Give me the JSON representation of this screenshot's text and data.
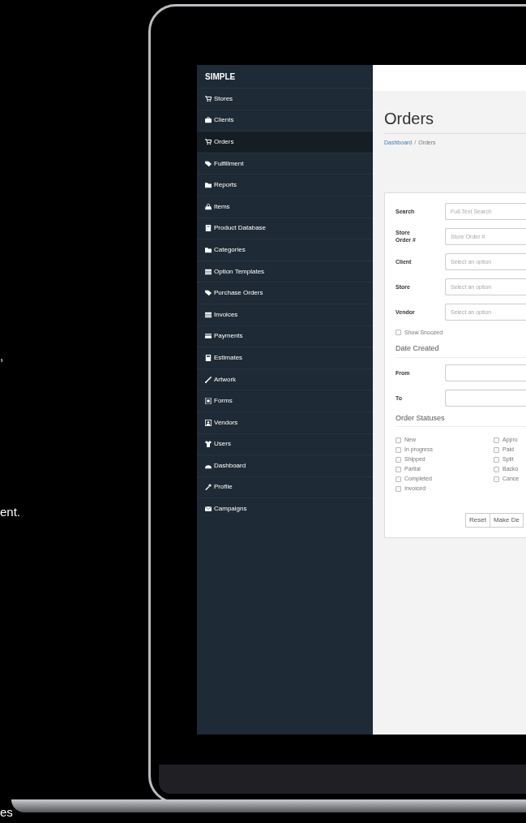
{
  "side_text": [
    ",",
    "ent.",
    "es"
  ],
  "sidebar": {
    "brand": "SIMPLE",
    "items": [
      {
        "label": "Stores",
        "kind": "cart",
        "selected": false
      },
      {
        "label": "Clients",
        "kind": "briefcase",
        "selected": false
      },
      {
        "label": "Orders",
        "kind": "cart",
        "selected": true
      },
      {
        "label": "Fulfillment",
        "kind": "tag",
        "selected": false
      },
      {
        "label": "Reports",
        "kind": "folder",
        "selected": false
      },
      {
        "label": "Items",
        "kind": "bag",
        "selected": false
      },
      {
        "label": "Product Database",
        "kind": "book",
        "selected": false
      },
      {
        "label": "Categories",
        "kind": "folder",
        "selected": false
      },
      {
        "label": "Option Templates",
        "kind": "table",
        "selected": false
      },
      {
        "label": "Purchase Orders",
        "kind": "tag",
        "selected": false
      },
      {
        "label": "Invoices",
        "kind": "table",
        "selected": false
      },
      {
        "label": "Payments",
        "kind": "card",
        "selected": false
      },
      {
        "label": "Estimates",
        "kind": "calculator",
        "selected": false
      },
      {
        "label": "Artwork",
        "kind": "brush",
        "selected": false
      },
      {
        "label": "Forms",
        "kind": "document",
        "selected": false
      },
      {
        "label": "Vendors",
        "kind": "contact",
        "selected": false
      },
      {
        "label": "Users",
        "kind": "shirt",
        "selected": false
      },
      {
        "label": "Dashboard",
        "kind": "gauge",
        "selected": false
      },
      {
        "label": "Profile",
        "kind": "wrench",
        "selected": false
      },
      {
        "label": "Campaigns",
        "kind": "envelope",
        "selected": false
      }
    ]
  },
  "page": {
    "title": "Orders",
    "separator": "/",
    "breadcrumb": [
      {
        "label": "Dashboard",
        "link": true
      },
      {
        "label": "Orders",
        "link": false
      }
    ]
  },
  "filters": {
    "fields": [
      {
        "label": "Search",
        "placeholder": "Full-Text Search"
      },
      {
        "label": "Store Order #",
        "placeholder": "Store Order #"
      },
      {
        "label": "Client",
        "placeholder": "Select an option"
      },
      {
        "label": "Store",
        "placeholder": "Select an option"
      },
      {
        "label": "Vendor",
        "placeholder": "Select an option"
      }
    ],
    "show_snoozed": {
      "label": "Show Snoozed",
      "checked": false
    },
    "date_heading": "Date Created",
    "dates": [
      {
        "label": "From"
      },
      {
        "label": "To"
      }
    ],
    "status_heading": "Order Statuses",
    "statuses": [
      {
        "label": "New",
        "checked": false
      },
      {
        "label": "In progress",
        "checked": false
      },
      {
        "label": "Shipped",
        "checked": false
      },
      {
        "label": "Partial",
        "checked": false
      },
      {
        "label": "Completed",
        "checked": false
      },
      {
        "label": "Invoiced",
        "checked": false
      },
      {
        "label": "Appro",
        "checked": false
      },
      {
        "label": "Paid",
        "checked": false
      },
      {
        "label": "Split",
        "checked": false
      },
      {
        "label": "Backo",
        "checked": false
      },
      {
        "label": "Cance",
        "checked": false
      }
    ],
    "buttons": [
      "Reset",
      "Make De"
    ]
  }
}
